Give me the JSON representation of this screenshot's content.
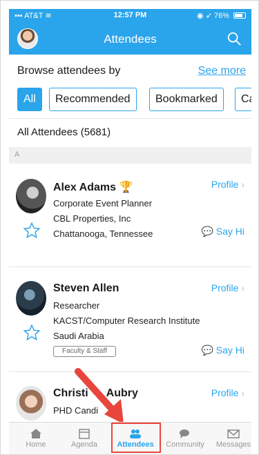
{
  "status": {
    "carrier": "AT&T",
    "time": "12:57 PM",
    "battery": "76%"
  },
  "nav": {
    "title": "Attendees"
  },
  "browse": {
    "label": "Browse attendees by",
    "see_more": "See more"
  },
  "filters": [
    {
      "label": "All"
    },
    {
      "label": "Recommended"
    },
    {
      "label": "Bookmarked"
    },
    {
      "label": "Cate"
    }
  ],
  "list_header": "All Attendees (5681)",
  "section_letter": "A",
  "attendees": [
    {
      "name": "Alex Adams",
      "title": "Corporate Event Planner",
      "company": "CBL Properties, Inc",
      "location": "Chattanooga, Tennessee",
      "profile_label": "Profile",
      "say_hi_label": "Say Hi"
    },
    {
      "name": "Steven Allen",
      "title": "Researcher",
      "company": "KACST/Computer Research Institute",
      "location": "Saudi Arabia",
      "tag": "Faculty & Staff",
      "profile_label": "Profile",
      "say_hi_label": "Say Hi"
    },
    {
      "name": "Christi",
      "name_rest": "Aubry",
      "title": "PHD Candi",
      "profile_label": "Profile"
    }
  ],
  "tabs": [
    {
      "label": "Home",
      "icon": "home-icon"
    },
    {
      "label": "Agenda",
      "icon": "calendar-icon"
    },
    {
      "label": "Attendees",
      "icon": "people-icon",
      "active": true
    },
    {
      "label": "Community",
      "icon": "chat-bubbles-icon"
    },
    {
      "label": "Messages",
      "icon": "envelope-icon"
    }
  ],
  "colors": {
    "accent": "#2aa4eb",
    "highlight": "#e8453c",
    "award": "#f5c020"
  }
}
